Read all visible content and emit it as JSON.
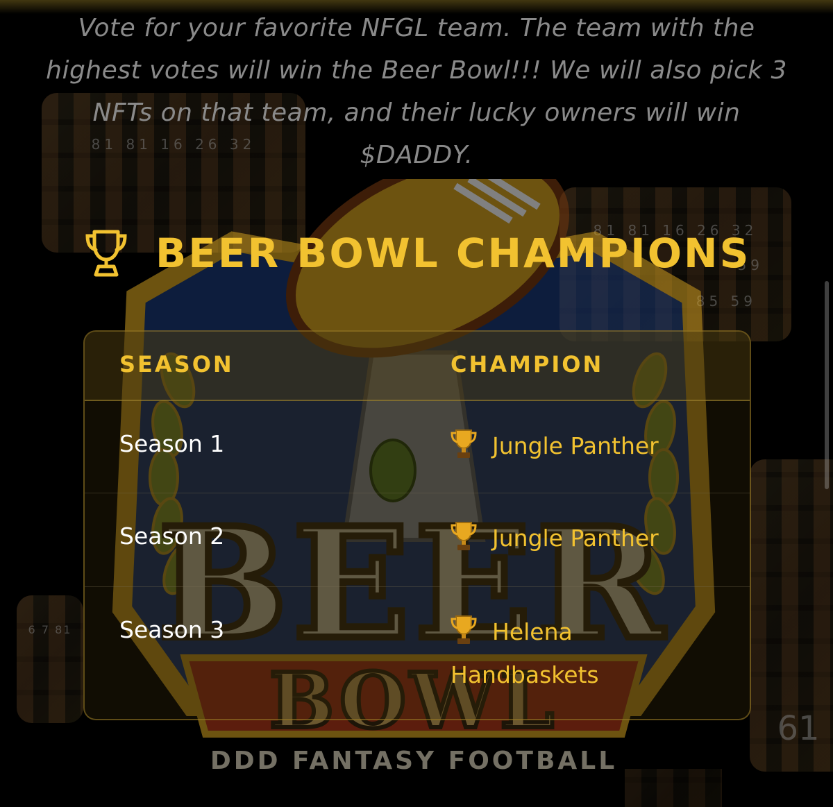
{
  "intro_text": "Vote for your favorite NFGL team. The team with the highest votes will win the Beer Bowl!!! We will also pick 3 NFTs on that team, and their lucky owners will win $DADDY.",
  "panel_numbers": {
    "top_left": "81  81  16  26  32",
    "top_right": "81  81  16  26  32",
    "top_right_lower": "59",
    "top_right_bottom": "85  59",
    "bottom_left": "6  7  81",
    "right_edge": "61"
  },
  "logo": {
    "word1": "BEER",
    "word2": "BOWL",
    "ribbon": "DDD FANTASY FOOTBALL"
  },
  "section": {
    "title": "BEER BOWL CHAMPIONS",
    "icon": "trophy-icon"
  },
  "table": {
    "headers": {
      "season": "SEASON",
      "champion": "CHAMPION"
    },
    "rows": [
      {
        "season": "Season 1",
        "champion": "Jungle Panther"
      },
      {
        "season": "Season 2",
        "champion": "Jungle Panther"
      },
      {
        "season": "Season 3",
        "champion": "Helena Handbaskets"
      }
    ]
  },
  "colors": {
    "accent": "#f2c230",
    "background": "#000000",
    "intro_text": "#8a8a8a"
  }
}
